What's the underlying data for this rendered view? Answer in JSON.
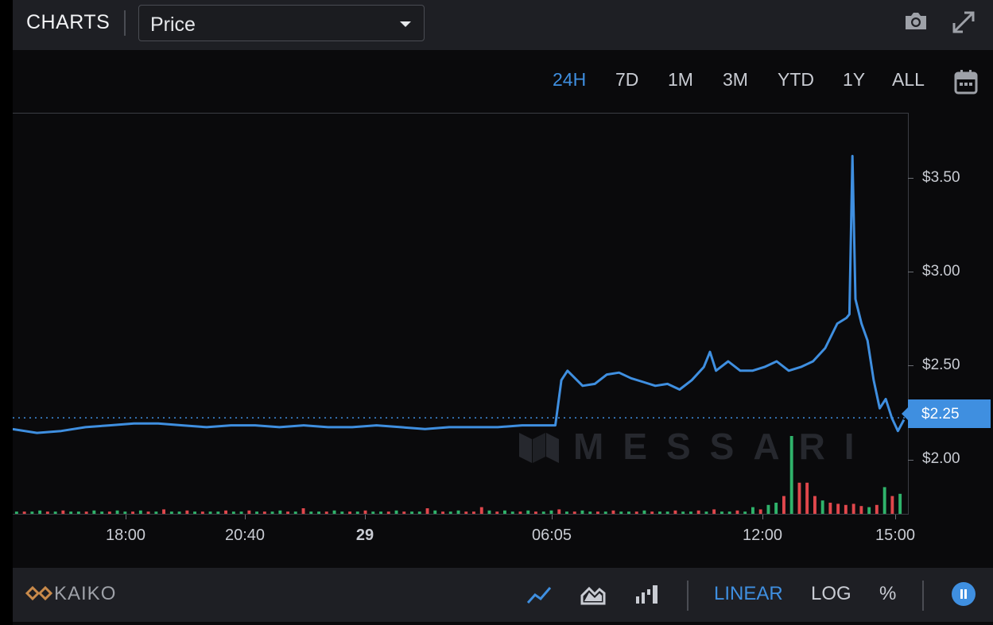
{
  "header": {
    "title": "CHARTS",
    "metric_select": {
      "value": "Price"
    },
    "icons": [
      "camera-icon",
      "expand-icon"
    ]
  },
  "ranges": {
    "items": [
      "24H",
      "7D",
      "1M",
      "3M",
      "YTD",
      "1Y",
      "ALL"
    ],
    "active": "24H",
    "calendar_icon": "calendar-icon"
  },
  "watermark": "MESSARI",
  "current_price_label": "$2.25",
  "footer": {
    "source": "KAIKO",
    "chart_type_icons": [
      "line-chart-icon",
      "area-chart-icon",
      "candle-chart-icon"
    ],
    "scales": [
      "LINEAR",
      "LOG",
      "%"
    ],
    "active_scale": "LINEAR",
    "pause_icon": "pause-icon"
  },
  "colors": {
    "accent": "#3f8fe0",
    "line": "#3f8fe0",
    "volume_up": "#2fb36b",
    "volume_down": "#e0474c",
    "background": "#0a0a0c",
    "panel": "#1e1f24"
  },
  "chart_data": {
    "type": "line",
    "title": "",
    "xlabel": "",
    "ylabel": "",
    "x_tick_labels": [
      "18:00",
      "20:40",
      "29",
      "06:05",
      "12:00",
      "15:00"
    ],
    "y_tick_labels": [
      "$2.00",
      "$2.50",
      "$3.00",
      "$3.50"
    ],
    "y_ticks": [
      2.0,
      2.5,
      3.0,
      3.5
    ],
    "ylim": [
      1.74,
      3.87
    ],
    "x_range": [
      "15:00",
      "15:30"
    ],
    "current_price": 2.25,
    "grid": false,
    "series": [
      {
        "x": [
          "15:00",
          "15:40",
          "16:20",
          "17:00",
          "17:40",
          "18:20",
          "19:00",
          "19:40",
          "20:20",
          "21:00",
          "21:40",
          "22:20",
          "23:00",
          "23:40",
          "00:20",
          "01:00",
          "01:40",
          "02:20",
          "03:00",
          "03:40",
          "04:20",
          "05:00",
          "05:40",
          "05:55",
          "06:05",
          "06:15",
          "06:40",
          "07:00",
          "07:20",
          "07:40",
          "08:00",
          "08:20",
          "08:40",
          "09:00",
          "09:20",
          "09:40",
          "10:00",
          "10:10",
          "10:20",
          "10:40",
          "11:00",
          "11:20",
          "11:40",
          "12:00",
          "12:20",
          "12:40",
          "13:00",
          "13:20",
          "13:40",
          "13:55",
          "14:00",
          "14:05",
          "14:10",
          "14:20",
          "14:30",
          "14:40",
          "14:50",
          "15:00",
          "15:10",
          "15:20",
          "15:30"
        ],
        "values": [
          2.19,
          2.17,
          2.18,
          2.2,
          2.21,
          2.22,
          2.22,
          2.21,
          2.2,
          2.21,
          2.21,
          2.2,
          2.21,
          2.2,
          2.2,
          2.21,
          2.2,
          2.19,
          2.2,
          2.2,
          2.2,
          2.21,
          2.21,
          2.21,
          2.45,
          2.5,
          2.42,
          2.43,
          2.48,
          2.49,
          2.46,
          2.44,
          2.42,
          2.43,
          2.4,
          2.45,
          2.52,
          2.6,
          2.5,
          2.55,
          2.5,
          2.5,
          2.52,
          2.55,
          2.5,
          2.52,
          2.55,
          2.62,
          2.75,
          2.78,
          2.8,
          3.64,
          2.88,
          2.75,
          2.66,
          2.45,
          2.3,
          2.35,
          2.25,
          2.18,
          2.24
        ]
      }
    ],
    "volume": {
      "label": "",
      "values": [
        0.2,
        0.2,
        0.2,
        0.3,
        0.2,
        0.2,
        0.3,
        0.2,
        0.2,
        0.2,
        0.3,
        0.2,
        0.2,
        0.3,
        0.2,
        0.2,
        0.3,
        0.2,
        0.2,
        0.4,
        0.2,
        0.2,
        0.3,
        0.2,
        0.2,
        0.2,
        0.2,
        0.3,
        0.2,
        0.2,
        0.3,
        0.2,
        0.2,
        0.2,
        0.3,
        0.2,
        0.2,
        0.5,
        0.2,
        0.2,
        0.2,
        0.3,
        0.2,
        0.2,
        0.2,
        0.3,
        0.2,
        0.2,
        0.2,
        0.3,
        0.2,
        0.2,
        0.2,
        0.5,
        0.3,
        0.2,
        0.2,
        0.3,
        0.2,
        0.2,
        0.6,
        0.3,
        0.2,
        0.3,
        0.2,
        0.2,
        0.3,
        0.2,
        0.2,
        0.3,
        0.4,
        0.2,
        0.2,
        0.3,
        0.2,
        0.2,
        0.2,
        0.3,
        0.2,
        0.2,
        0.2,
        0.3,
        0.2,
        0.2,
        0.2,
        0.3,
        0.2,
        0.2,
        0.3,
        0.2,
        0.4,
        0.2,
        0.2,
        0.3,
        0.2,
        0.6,
        0.4,
        0.8,
        1.0,
        1.6,
        7.0,
        2.8,
        2.8,
        1.6,
        1.2,
        1.0,
        0.9,
        0.8,
        0.9,
        0.7,
        0.6,
        0.8,
        2.4,
        1.6,
        1.8
      ],
      "direction": [
        "u",
        "d",
        "u",
        "u",
        "d",
        "u",
        "d",
        "u",
        "u",
        "d",
        "u",
        "u",
        "d",
        "u",
        "u",
        "d",
        "u",
        "d",
        "u",
        "d",
        "u",
        "u",
        "d",
        "u",
        "d",
        "u",
        "u",
        "d",
        "u",
        "u",
        "d",
        "u",
        "d",
        "u",
        "u",
        "d",
        "u",
        "d",
        "u",
        "u",
        "d",
        "u",
        "u",
        "d",
        "u",
        "d",
        "u",
        "u",
        "d",
        "u",
        "d",
        "u",
        "u",
        "d",
        "u",
        "d",
        "u",
        "u",
        "d",
        "d",
        "d",
        "u",
        "d",
        "u",
        "u",
        "d",
        "u",
        "d",
        "u",
        "u",
        "d",
        "u",
        "d",
        "u",
        "u",
        "d",
        "u",
        "d",
        "u",
        "u",
        "d",
        "u",
        "d",
        "u",
        "u",
        "d",
        "u",
        "u",
        "d",
        "u",
        "d",
        "u",
        "u",
        "d",
        "u",
        "u",
        "d",
        "u",
        "u",
        "d",
        "u",
        "d",
        "d",
        "d",
        "u",
        "d",
        "d",
        "d",
        "d",
        "d",
        "u",
        "d",
        "u",
        "d",
        "u"
      ]
    }
  }
}
